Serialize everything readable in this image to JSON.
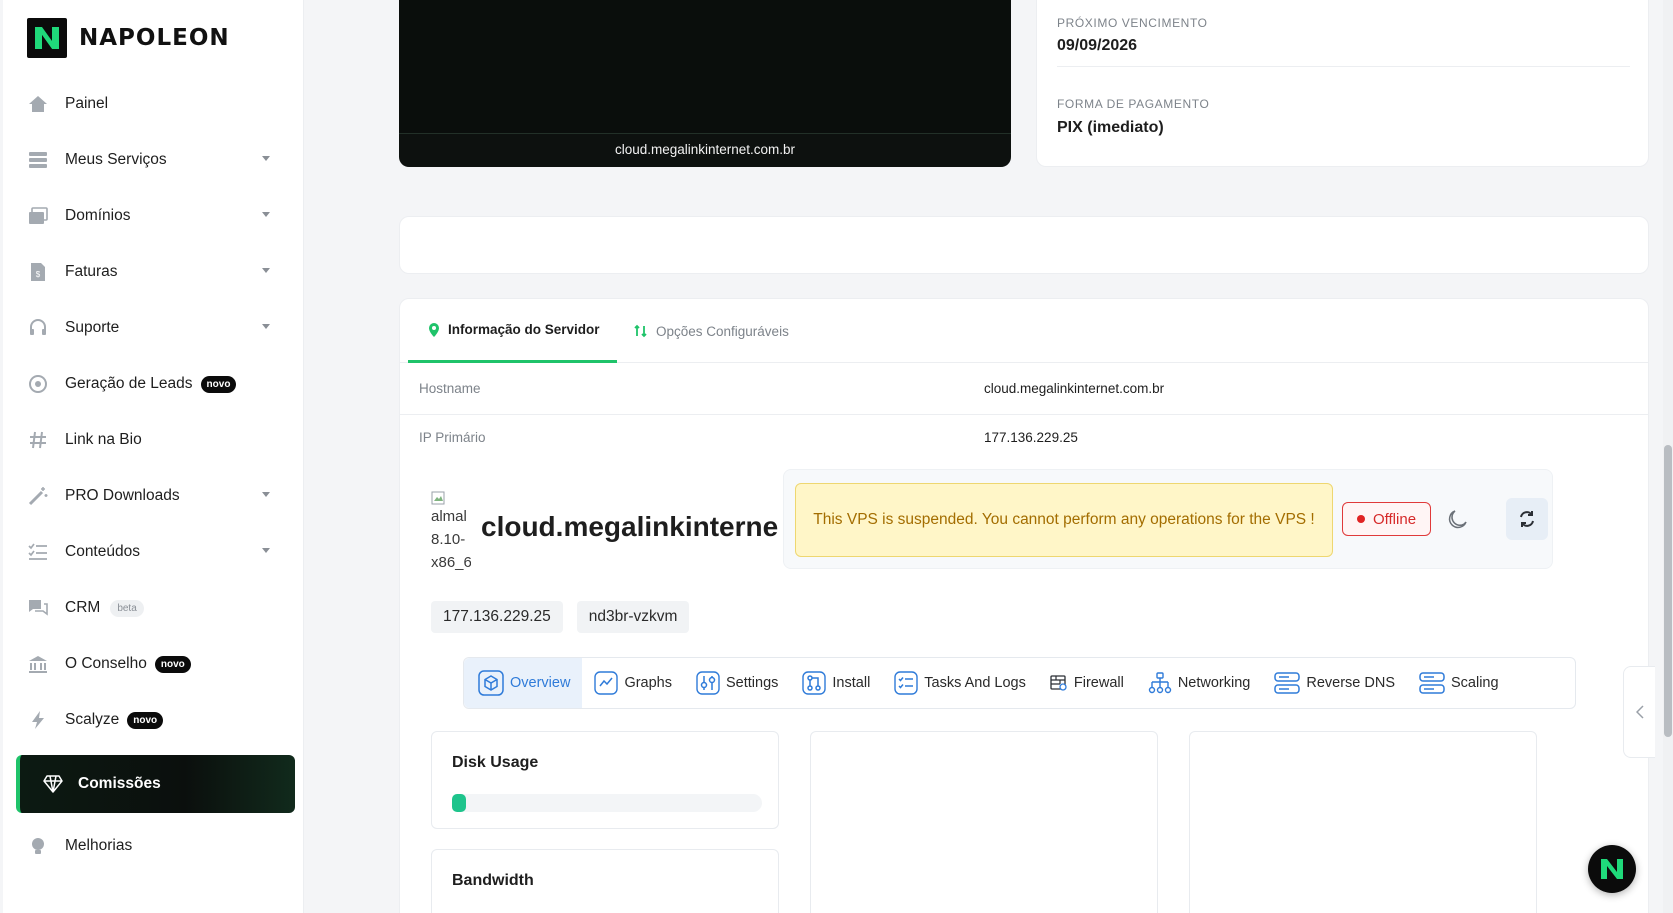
{
  "brand": {
    "name": "NAPOLEON",
    "accent": "#1fc36a"
  },
  "sidebar": {
    "items": [
      {
        "label": "Painel",
        "icon": "home-icon",
        "caret": false
      },
      {
        "label": "Meus Serviços",
        "icon": "server-icon",
        "caret": true
      },
      {
        "label": "Domínios",
        "icon": "window-icon",
        "caret": true
      },
      {
        "label": "Faturas",
        "icon": "invoice-icon",
        "caret": true
      },
      {
        "label": "Suporte",
        "icon": "headset-icon",
        "caret": true
      },
      {
        "label": "Geração de Leads",
        "icon": "target-icon",
        "caret": false,
        "badge": "novo"
      },
      {
        "label": "Link na Bio",
        "icon": "hash-icon",
        "caret": false
      },
      {
        "label": "PRO Downloads",
        "icon": "magic-wand-icon",
        "caret": true
      },
      {
        "label": "Conteúdos",
        "icon": "list-icon",
        "caret": true
      },
      {
        "label": "CRM",
        "icon": "chat-icon",
        "caret": false,
        "badge": "beta"
      },
      {
        "label": "O Conselho",
        "icon": "bank-icon",
        "caret": false,
        "badge": "novo"
      },
      {
        "label": "Scalyze",
        "icon": "bolt-icon",
        "caret": false,
        "badge": "novo"
      }
    ],
    "active": {
      "label": "Comissões",
      "icon": "diamond-icon"
    },
    "bottom": {
      "label": "Melhorias",
      "icon": "lightbulb-icon"
    }
  },
  "preview": {
    "caption": "cloud.megalinkinternet.com.br"
  },
  "billing": {
    "due_label": "PRÓXIMO VENCIMENTO",
    "due_value": "09/09/2026",
    "payment_label": "FORMA DE PAGAMENTO",
    "payment_value": "PIX (imediato)"
  },
  "server_tabs": [
    {
      "label": "Informação do Servidor",
      "active": true
    },
    {
      "label": "Opções Configuráveis",
      "active": false
    }
  ],
  "server_info": {
    "hostname_label": "Hostname",
    "hostname_value": "cloud.megalinkinternet.com.br",
    "ip_label": "IP Primário",
    "ip_value": "177.136.229.25"
  },
  "vps": {
    "os_alt": "almal 8.10-x86_6",
    "host": "cloud.megalinkinterne",
    "alert": "This VPS is suspended. You cannot perform any operations for the VPS !",
    "status": "Offline",
    "ip_chip": "177.136.229.25",
    "id_chip": "nd3br-vzkvm",
    "tabs": [
      "Overview",
      "Graphs",
      "Settings",
      "Install",
      "Tasks And Logs",
      "Firewall",
      "Networking",
      "Reverse DNS",
      "Scaling"
    ],
    "active_tab": "Overview",
    "disk_title": "Disk Usage",
    "disk_fraction": 0.04,
    "bandwidth_title": "Bandwidth"
  }
}
